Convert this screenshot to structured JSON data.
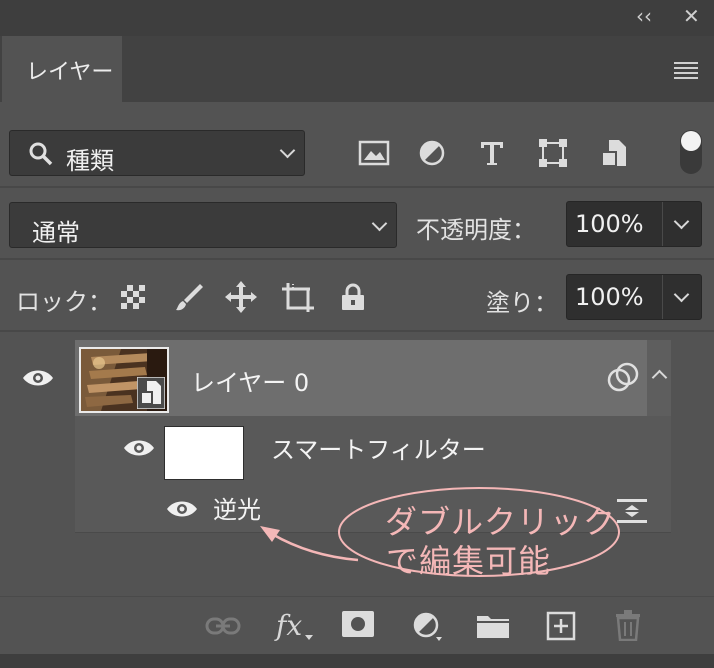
{
  "window": {
    "collapse_label": "‹‹",
    "close_label": "✕"
  },
  "tab": {
    "title": "レイヤー"
  },
  "filter": {
    "kind_label": "種類"
  },
  "blend": {
    "mode": "通常",
    "opacity_label": "不透明度：",
    "opacity_value": "100%"
  },
  "lock": {
    "label": "ロック：",
    "fill_label": "塗り：",
    "fill_value": "100%"
  },
  "layers": {
    "layer0_name": "レイヤー 0",
    "smart_filters_label": "スマートフィルター",
    "filter_name": "逆光"
  },
  "annotation": {
    "line1": "ダブルクリック",
    "line2": "で編集可能"
  },
  "bottom": {
    "fx_label": "fx"
  },
  "colors": {
    "accent_pink": "#f4b7b7",
    "panel": "#535353",
    "highlight": "#6e6e6e"
  }
}
